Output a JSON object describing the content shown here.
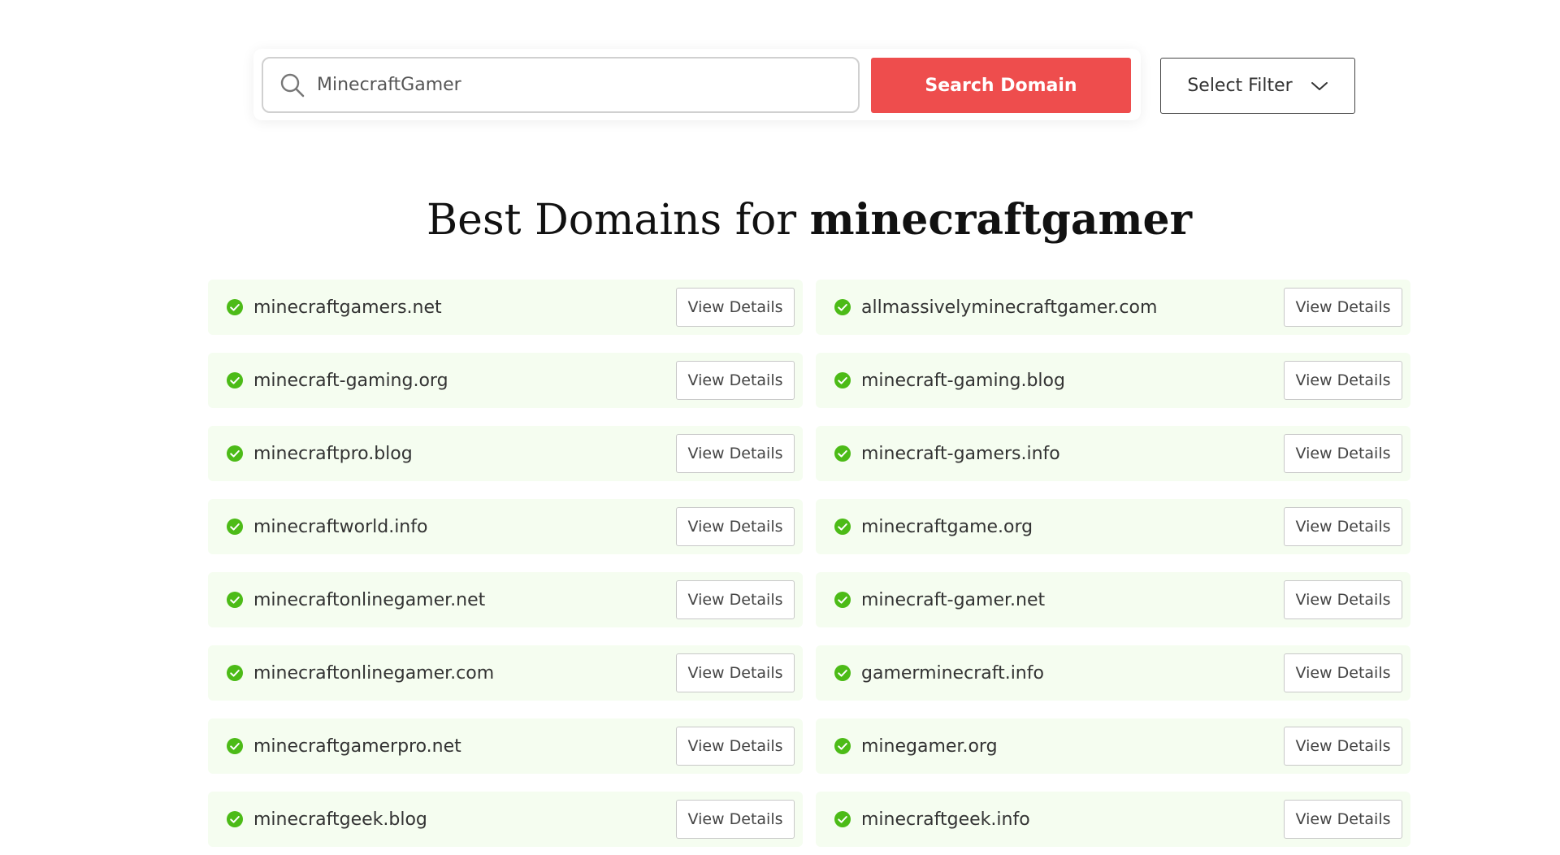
{
  "search": {
    "value": "MinecraftGamer",
    "button_label": "Search Domain",
    "icon": "search-icon"
  },
  "filter": {
    "label": "Select Filter",
    "icon": "chevron-down-icon"
  },
  "heading": {
    "prefix": "Best Domains for ",
    "keyword": "minecraftgamer"
  },
  "colors": {
    "accent": "#ee4d4d",
    "available_check": "#4cbb17",
    "row_background": "#f5fdf0"
  },
  "results": {
    "button_label": "View Details",
    "status_icon": "check-circle-icon",
    "rows": [
      [
        "minecraftgamers.net",
        "allmassivelyminecraftgamer.com"
      ],
      [
        "minecraft-gaming.org",
        "minecraft-gaming.blog"
      ],
      [
        "minecraftpro.blog",
        "minecraft-gamers.info"
      ],
      [
        "minecraftworld.info",
        "minecraftgame.org"
      ],
      [
        "minecraftonlinegamer.net",
        "minecraft-gamer.net"
      ],
      [
        "minecraftonlinegamer.com",
        "gamerminecraft.info"
      ],
      [
        "minecraftgamerpro.net",
        "minegamer.org"
      ],
      [
        "minecraftgeek.blog",
        "minecraftgeek.info"
      ]
    ]
  }
}
